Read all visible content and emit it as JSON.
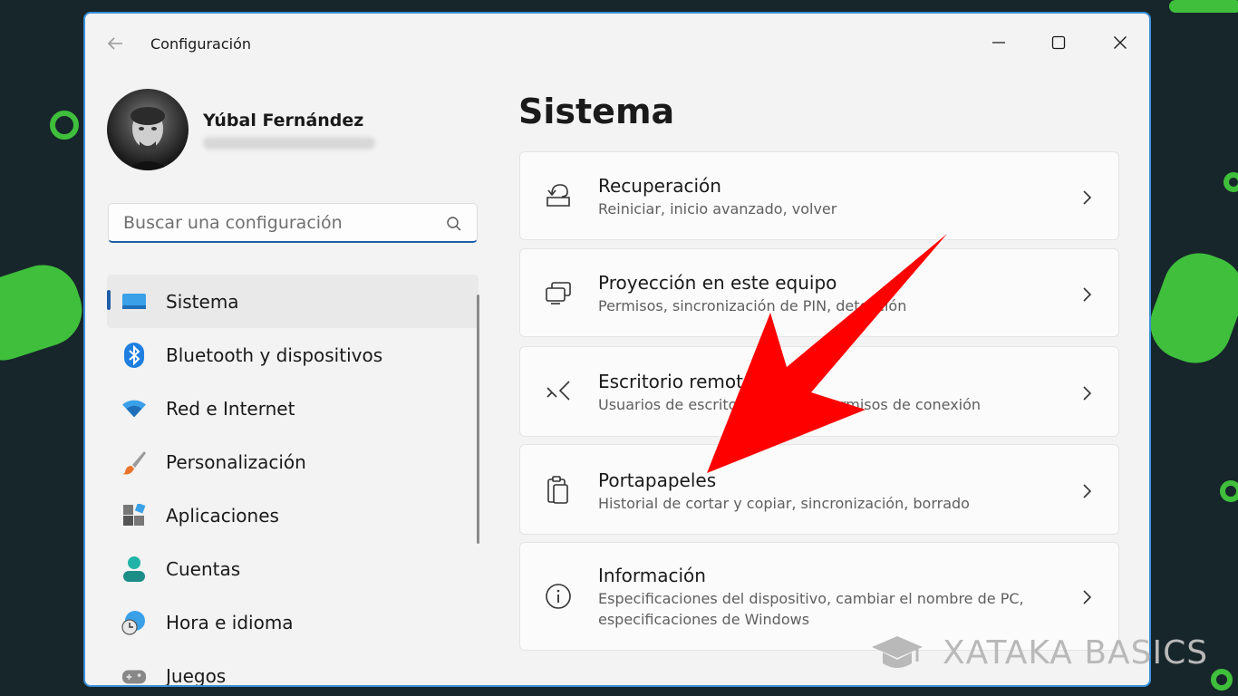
{
  "window": {
    "title": "Configuración"
  },
  "profile": {
    "name": "Yúbal Fernández"
  },
  "search": {
    "placeholder": "Buscar una configuración"
  },
  "nav": {
    "items": [
      {
        "label": "Sistema",
        "icon": "monitor-icon",
        "active": true
      },
      {
        "label": "Bluetooth y dispositivos",
        "icon": "bluetooth-icon"
      },
      {
        "label": "Red e Internet",
        "icon": "wifi-icon"
      },
      {
        "label": "Personalización",
        "icon": "paintbrush-icon"
      },
      {
        "label": "Aplicaciones",
        "icon": "apps-icon"
      },
      {
        "label": "Cuentas",
        "icon": "user-icon"
      },
      {
        "label": "Hora e idioma",
        "icon": "globe-clock-icon"
      },
      {
        "label": "Juegos",
        "icon": "gamepad-icon"
      }
    ]
  },
  "main": {
    "title": "Sistema",
    "cards": [
      {
        "title": "Recuperación",
        "desc": [
          "Reiniciar, inicio avanzado, volver"
        ],
        "icon": "recovery-icon"
      },
      {
        "title": "Proyección en este equipo",
        "desc": [
          "Permisos, sincronización de PIN, detección"
        ],
        "icon": "projection-icon"
      },
      {
        "title": "Escritorio remoto",
        "desc": [
          "Usuarios de escritorio remoto, permisos de conexión"
        ],
        "icon": "remote-desktop-icon"
      },
      {
        "title": "Portapapeles",
        "desc": [
          "Historial de cortar y copiar, sincronización, borrado"
        ],
        "icon": "clipboard-icon"
      },
      {
        "title": "Información",
        "desc": [
          "Especificaciones del dispositivo, cambiar el nombre de PC,",
          "especificaciones de Windows"
        ],
        "icon": "info-icon"
      }
    ]
  },
  "watermark": {
    "text": "XATAKA BASICS"
  },
  "colors": {
    "accent": "#1f5fa9",
    "arrow": "#ff0000",
    "wallpaper_green": "#3fbf3c"
  }
}
